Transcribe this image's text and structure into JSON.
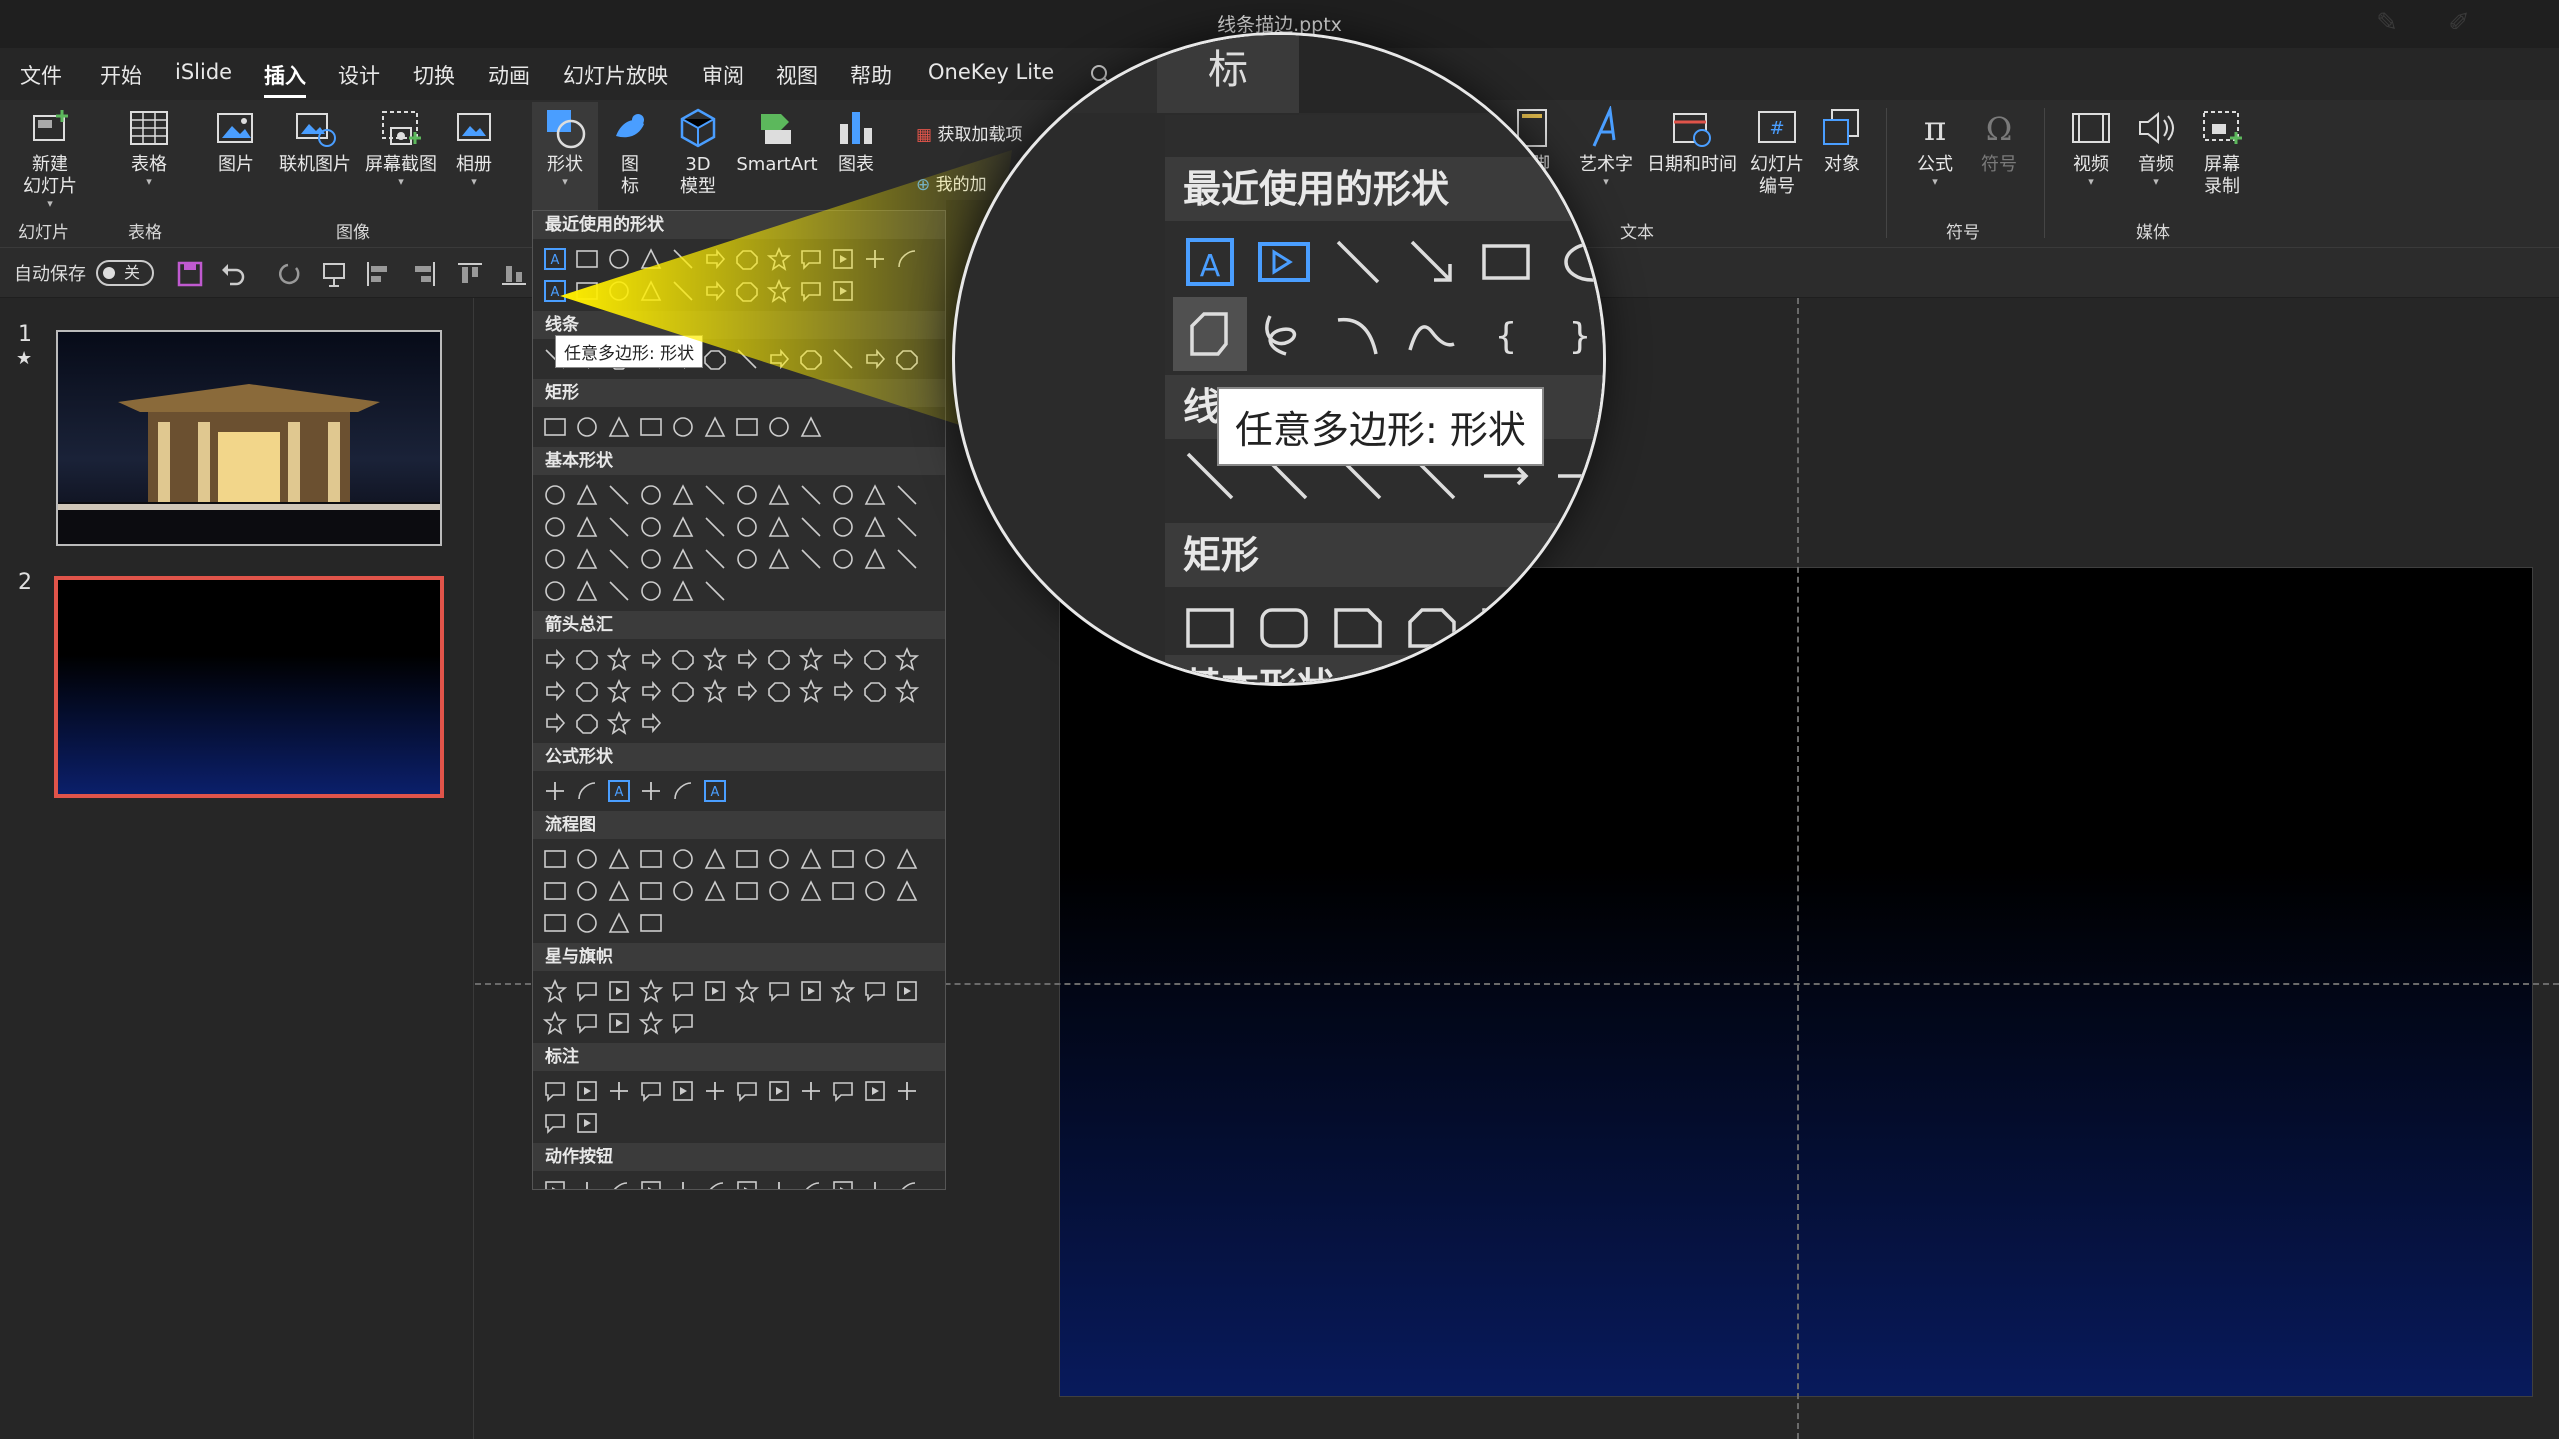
{
  "window": {
    "title": "线条描边.pptx"
  },
  "menu": {
    "items": [
      "文件",
      "开始",
      "iSlide",
      "插入",
      "设计",
      "切换",
      "动画",
      "幻灯片放映",
      "审阅",
      "视图",
      "帮助",
      "OneKey Lite"
    ],
    "active": "插入"
  },
  "ribbon": {
    "new_slide": "新建\n幻灯片",
    "table": "表格",
    "picture": "图片",
    "online_picture": "联机图片",
    "screenshot": "屏幕截图",
    "album": "相册",
    "shapes": "形状",
    "icons": "图\n标",
    "model3d": "3D\n模型",
    "smartart": "SmartArt",
    "chart": "图表",
    "get_addins": "获取加载项",
    "my_addins": "我的加",
    "addins_group": "加",
    "header_footer": "页脚",
    "wordart": "艺术字",
    "datetime": "日期和时间",
    "slide_number": "幻灯片\n编号",
    "object": "对象",
    "equation": "公式",
    "symbol": "符号",
    "video": "视频",
    "audio": "音频",
    "screen_record": "屏幕\n录制",
    "groups": {
      "slides": "幻灯片",
      "tables": "表格",
      "images": "图像",
      "text": "文本",
      "symbols": "符号",
      "media": "媒体"
    }
  },
  "qat": {
    "autosave_label": "自动保存",
    "toggle_state": "关"
  },
  "slides": {
    "numbers": [
      "1",
      "2"
    ],
    "star": "★",
    "selected": 2
  },
  "shapes_dropdown": {
    "sections": [
      "最近使用的形状",
      "线条",
      "矩形",
      "基本形状",
      "箭头总汇",
      "公式形状",
      "流程图",
      "星与旗帜",
      "标注",
      "动作按钮"
    ],
    "counts": [
      22,
      12,
      9,
      42,
      28,
      6,
      28,
      17,
      14,
      12
    ],
    "tooltip": "任意多边形: 形状"
  },
  "zoom": {
    "tab_label": "标",
    "section_recent": "最近使用的形状",
    "section_lines": "线条",
    "section_rect": "矩形",
    "section_basic": "基本形状",
    "tooltip": "任意多边形: 形状",
    "ribbon_fragment": "页脚"
  },
  "colors": {
    "accent": "#4a9eff",
    "selection": "#e0544a",
    "highlight": "#ffee00",
    "slide_bottom": "#081a5c"
  }
}
